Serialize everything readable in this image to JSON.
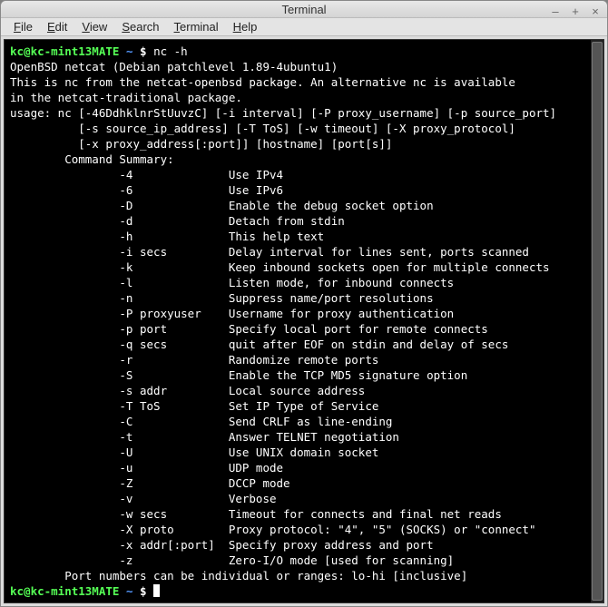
{
  "window": {
    "title": "Terminal"
  },
  "menus": [
    "File",
    "Edit",
    "View",
    "Search",
    "Terminal",
    "Help"
  ],
  "prompt": {
    "user_host": "kc@kc-mint13MATE",
    "cwd": "~",
    "symbol": "$"
  },
  "command": "nc -h",
  "output_lines": [
    "OpenBSD netcat (Debian patchlevel 1.89-4ubuntu1)",
    "This is nc from the netcat-openbsd package. An alternative nc is available",
    "in the netcat-traditional package.",
    "usage: nc [-46DdhklnrStUuvzC] [-i interval] [-P proxy_username] [-p source_port]",
    "          [-s source_ip_address] [-T ToS] [-w timeout] [-X proxy_protocol]",
    "          [-x proxy_address[:port]] [hostname] [port[s]]",
    "        Command Summary:",
    "                -4              Use IPv4",
    "                -6              Use IPv6",
    "                -D              Enable the debug socket option",
    "                -d              Detach from stdin",
    "                -h              This help text",
    "                -i secs         Delay interval for lines sent, ports scanned",
    "                -k              Keep inbound sockets open for multiple connects",
    "                -l              Listen mode, for inbound connects",
    "                -n              Suppress name/port resolutions",
    "                -P proxyuser    Username for proxy authentication",
    "                -p port         Specify local port for remote connects",
    "                -q secs         quit after EOF on stdin and delay of secs",
    "                -r              Randomize remote ports",
    "                -S              Enable the TCP MD5 signature option",
    "                -s addr         Local source address",
    "                -T ToS          Set IP Type of Service",
    "                -C              Send CRLF as line-ending",
    "                -t              Answer TELNET negotiation",
    "                -U              Use UNIX domain socket",
    "                -u              UDP mode",
    "                -Z              DCCP mode",
    "                -v              Verbose",
    "                -w secs         Timeout for connects and final net reads",
    "                -X proto        Proxy protocol: \"4\", \"5\" (SOCKS) or \"connect\"",
    "                -x addr[:port]  Specify proxy address and port",
    "                -z              Zero-I/O mode [used for scanning]",
    "        Port numbers can be individual or ranges: lo-hi [inclusive]"
  ]
}
